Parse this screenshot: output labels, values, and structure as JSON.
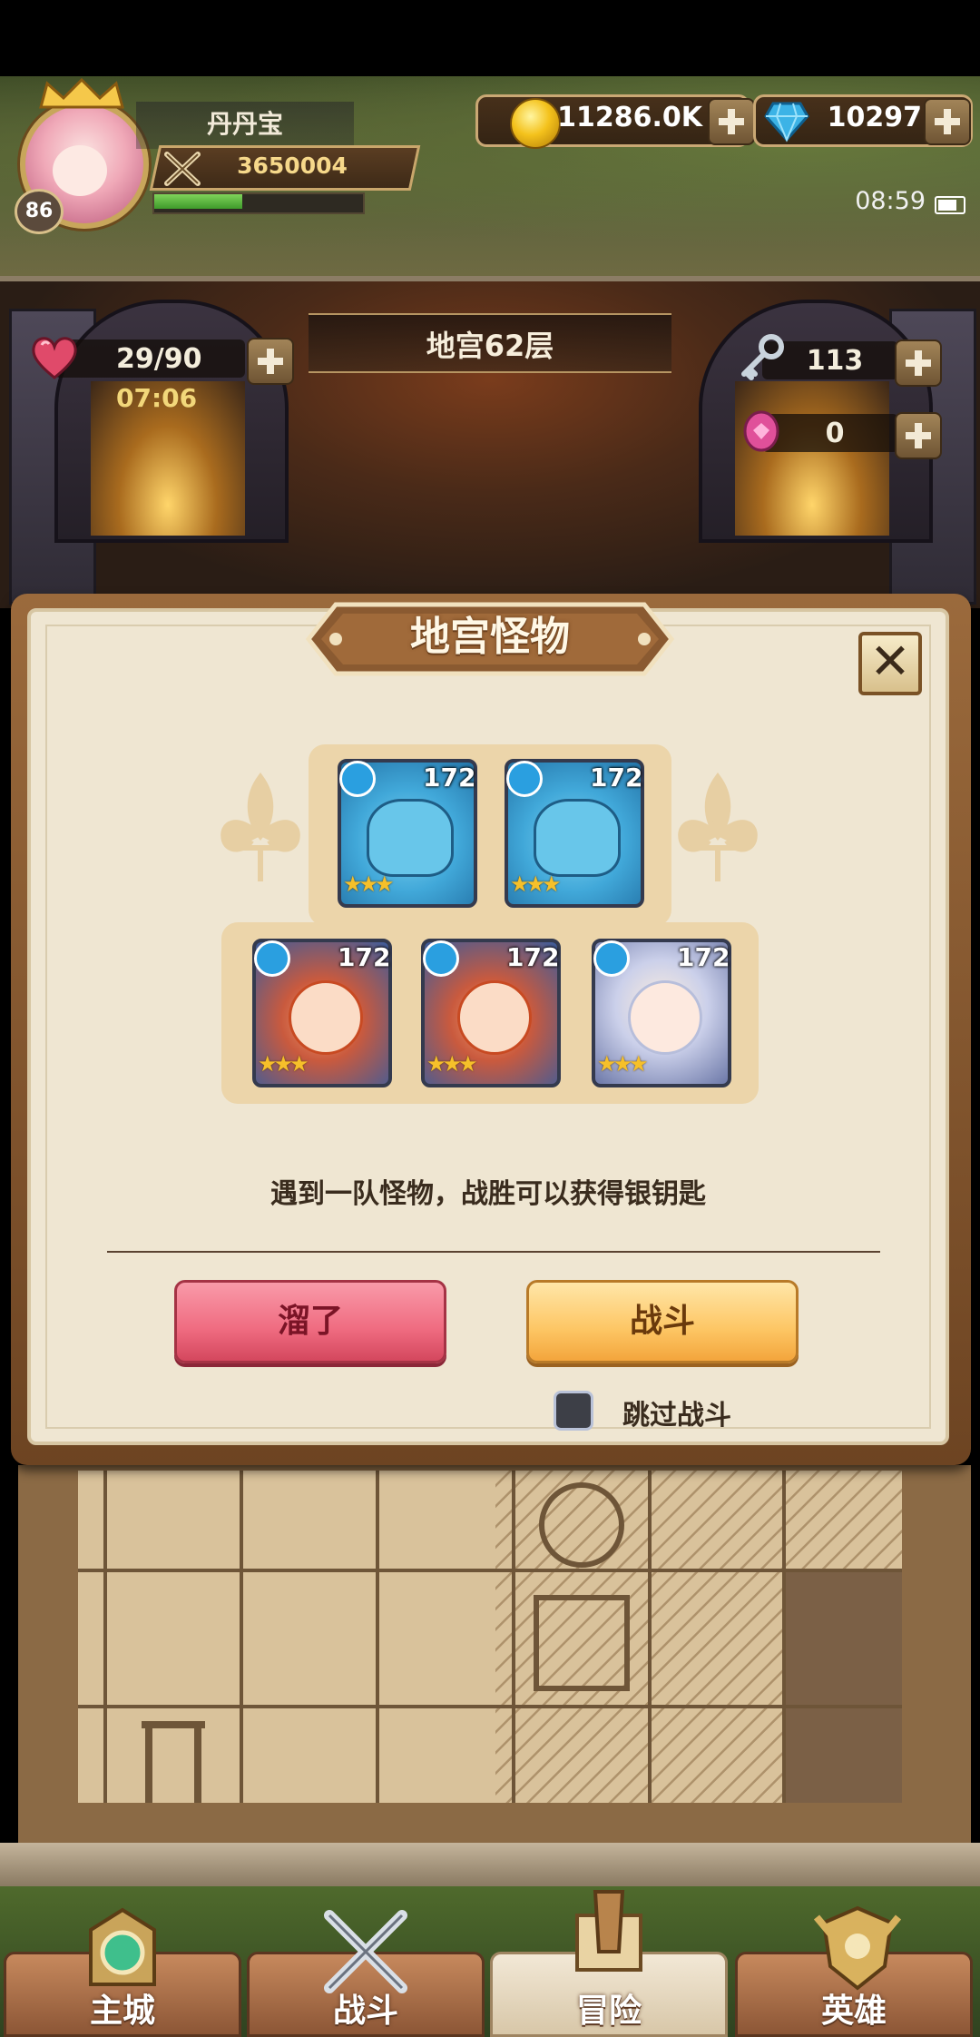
{
  "player": {
    "name": "丹丹宝",
    "level": "86",
    "power": "3650004",
    "exp_fraction": 0.43
  },
  "currencies": {
    "gold": "11286.0K",
    "diamonds": "10297"
  },
  "system": {
    "time": "08:59"
  },
  "dungeon": {
    "floor_title": "地宫62层",
    "stamina": "29/90",
    "stamina_timer": "07:06",
    "silver_keys": "113",
    "eggs": "0"
  },
  "dialog": {
    "title": "地宫怪物",
    "message": "遇到一队怪物，战胜可以获得银钥匙",
    "flee_label": "溜了",
    "fight_label": "战斗",
    "skip_label": "跳过战斗",
    "skip_checked": false,
    "monsters": [
      {
        "level": "172",
        "stars": 3,
        "kind": "blue-beast"
      },
      {
        "level": "172",
        "stars": 3,
        "kind": "blue-beast"
      },
      {
        "level": "172",
        "stars": 3,
        "kind": "red-hair-warrior"
      },
      {
        "level": "172",
        "stars": 3,
        "kind": "red-hair-warrior"
      },
      {
        "level": "172",
        "stars": 3,
        "kind": "silver-hair-girl"
      }
    ]
  },
  "bottom_nav": {
    "tabs": [
      {
        "label": "主城",
        "icon": "city-icon",
        "active": false
      },
      {
        "label": "战斗",
        "icon": "crossed-swords-icon",
        "active": false
      },
      {
        "label": "冒险",
        "icon": "map-scroll-icon",
        "active": true
      },
      {
        "label": "英雄",
        "icon": "hero-crest-icon",
        "active": false
      }
    ]
  },
  "colors": {
    "flee_button": "#ef6b80",
    "fight_button": "#fdc664",
    "dialog_bg": "#efe6d2",
    "frame_brown": "#9b6a3c"
  }
}
